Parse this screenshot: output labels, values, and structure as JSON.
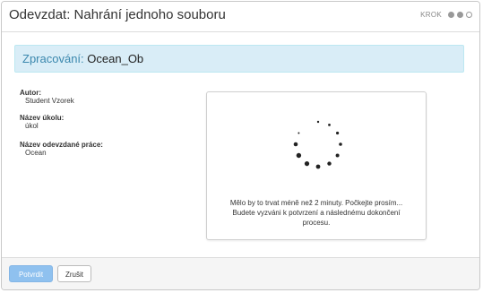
{
  "dialog": {
    "title": "Odevzdat: Nahrání jednoho souboru",
    "step_label": "KROK",
    "steps": [
      "done",
      "active",
      "pending"
    ]
  },
  "banner": {
    "label": "Zpracování:",
    "value": "Ocean_Ob",
    "color": "#d9edf7"
  },
  "meta": [
    {
      "key": "Autor:",
      "value": "Student Vzorek"
    },
    {
      "key": "Název úkolu:",
      "value": "úkol"
    },
    {
      "key": "Název odevzdané práce:",
      "value": "Ocean"
    }
  ],
  "processing": {
    "message_line1": "Mělo by to trvat méně než 2 minuty. Počkejte prosím...",
    "message_line2": "Budete vyzváni k potvrzení a následnému dokončení",
    "message_line3": "procesu."
  },
  "footer": {
    "confirm_label": "Potvrdit",
    "cancel_label": "Zrušit"
  }
}
